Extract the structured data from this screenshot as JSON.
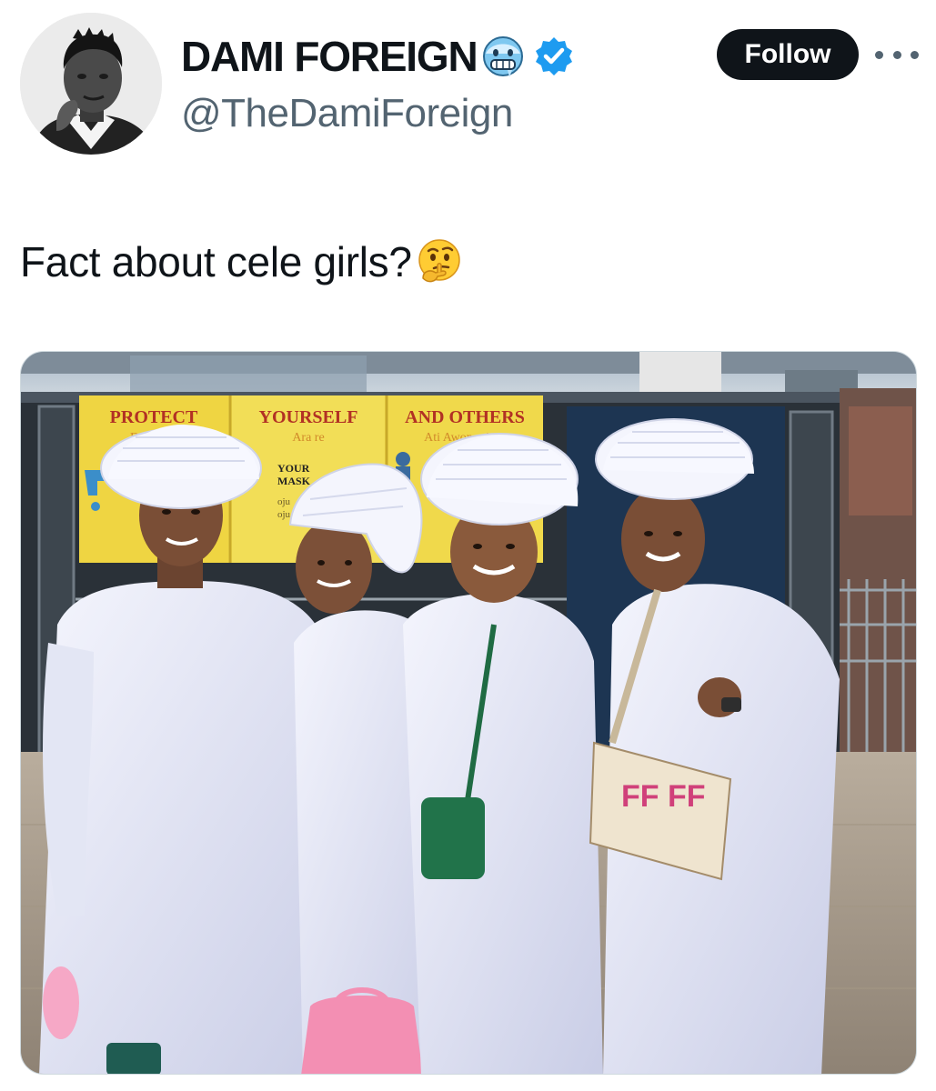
{
  "tweet": {
    "author": {
      "display_name": "DAMI FOREIGN",
      "handle": "@TheDamiForeign",
      "status_emoji": "cold-face-emoji",
      "verified": true,
      "verified_color": "#1d9bf0"
    },
    "follow_label": "Follow",
    "more_icon": "ellipsis-icon",
    "text": "Fact about cele girls?",
    "text_emoji": "thinking-face-emoji",
    "media": {
      "sign": {
        "word1": "PROTECT",
        "word1_sub": "Dab",
        "word2": "YOURSELF",
        "word2_sub": "Ara re",
        "word3": "AND OTHERS",
        "word3_sub": "Ati Awon miran",
        "mask_line1": "YOUR",
        "mask_line2": "MASK",
        "mask_line3": "oju",
        "mask_line4": "oju re"
      },
      "bag_text": "FF FF"
    }
  },
  "colors": {
    "text_primary": "#0f1419",
    "text_secondary": "#536471",
    "follow_bg": "#0f1419",
    "follow_fg": "#ffffff",
    "sign_yellow": "#f2dc4c",
    "sign_red": "#c0392b",
    "garment_white": "#e9ecf7"
  }
}
